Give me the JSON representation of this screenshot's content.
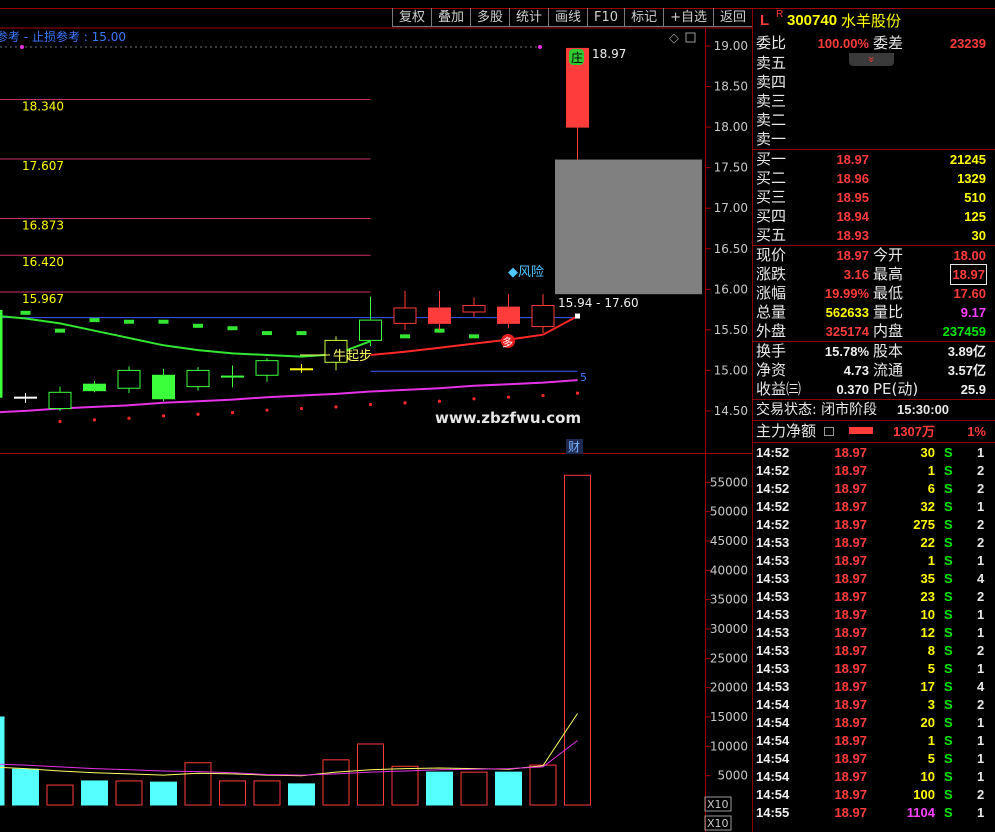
{
  "toolbar": {
    "buttons": [
      "复权",
      "叠加",
      "多股",
      "统计",
      "画线",
      "F10",
      "标记",
      "+自选",
      "返回"
    ]
  },
  "chart": {
    "ref_text": "参考 - 止损参考 : 15.00",
    "zhuang": "庄",
    "top_price": "18.97",
    "risk": "◆风险",
    "zone_label": "15.94 - 17.60",
    "niu": "牛起步",
    "duo": "多",
    "watermark": "www.zbzfwu.com",
    "cai": "财",
    "guide_label": "5",
    "x10_a": "X10",
    "x10_b": "X10"
  },
  "chart_data": [
    {
      "type": "candlestick",
      "price_ticks": [
        "19.00",
        "18.50",
        "18.00",
        "17.50",
        "17.00",
        "16.50",
        "16.00",
        "15.50",
        "15.00",
        "14.50"
      ],
      "candles": [
        {
          "o": 15.74,
          "c": 14.67,
          "h": 15.74,
          "l": 14.67,
          "color": "#3cff3c",
          "filled": true
        },
        {
          "o": 14.67,
          "c": 14.66,
          "h": 14.72,
          "l": 14.6,
          "color": "#ffffff",
          "filled": false
        },
        {
          "o": 14.53,
          "c": 14.73,
          "h": 14.8,
          "l": 14.5,
          "color": "#3cff3c",
          "filled": false
        },
        {
          "o": 14.83,
          "c": 14.75,
          "h": 14.87,
          "l": 14.73,
          "color": "#3cff3c",
          "filled": true
        },
        {
          "o": 14.78,
          "c": 15.0,
          "h": 15.05,
          "l": 14.72,
          "color": "#3cff3c",
          "filled": false
        },
        {
          "o": 14.94,
          "c": 14.65,
          "h": 15.02,
          "l": 14.62,
          "color": "#3cff3c",
          "filled": true
        },
        {
          "o": 14.8,
          "c": 15.0,
          "h": 15.04,
          "l": 14.75,
          "color": "#3cff3c",
          "filled": false
        },
        {
          "o": 14.93,
          "c": 14.92,
          "h": 15.06,
          "l": 14.79,
          "color": "#3cff3c",
          "filled": false
        },
        {
          "o": 14.94,
          "c": 15.12,
          "h": 15.15,
          "l": 14.86,
          "color": "#3cff3c",
          "filled": false
        },
        {
          "o": 15.02,
          "c": 15.01,
          "h": 15.08,
          "l": 14.97,
          "color": "#ffff00",
          "filled": false
        },
        {
          "o": 15.1,
          "c": 15.37,
          "h": 15.42,
          "l": 15.0,
          "color": "#c8ff3c",
          "filled": false
        },
        {
          "o": 15.37,
          "c": 15.62,
          "h": 15.91,
          "l": 15.3,
          "color": "#3cff3c",
          "filled": false
        },
        {
          "o": 15.58,
          "c": 15.77,
          "h": 15.98,
          "l": 15.5,
          "color": "#ff3c3c",
          "filled": false
        },
        {
          "o": 15.58,
          "c": 15.77,
          "h": 15.98,
          "l": 15.5,
          "color": "#ff3c3c",
          "filled": true
        },
        {
          "o": 15.72,
          "c": 15.8,
          "h": 15.9,
          "l": 15.66,
          "color": "#ff3c3c",
          "filled": false
        },
        {
          "o": 15.58,
          "c": 15.78,
          "h": 15.94,
          "l": 15.52,
          "color": "#ff3c3c",
          "filled": true
        },
        {
          "o": 15.54,
          "c": 15.8,
          "h": 15.94,
          "l": 15.46,
          "color": "#ff3c3c",
          "filled": false
        },
        {
          "o": 18.0,
          "c": 18.97,
          "h": 18.97,
          "l": 17.6,
          "color": "#ff3c3c",
          "filled": true
        }
      ],
      "levels": [
        "18.340",
        "17.607",
        "16.873",
        "16.420",
        "15.967"
      ],
      "level_color": "#c83264",
      "zone": {
        "low": 15.94,
        "high": 17.6,
        "color": "#808080"
      },
      "guides": [
        {
          "price": 15.65,
          "from": 0,
          "color": "#3c5aff"
        },
        {
          "price": 14.99,
          "from": 11,
          "color": "#3c5aff"
        }
      ],
      "series": [
        {
          "start": 0,
          "color": "#32e632",
          "values": [
            15.68,
            15.64,
            15.58,
            15.49,
            15.4,
            15.31,
            15.25,
            15.21,
            15.19,
            15.17,
            15.2,
            15.36
          ]
        },
        {
          "start": 11,
          "color": "#ff2828",
          "values": [
            15.19,
            15.23,
            15.28,
            15.33,
            15.38,
            15.44,
            15.67
          ]
        },
        {
          "start": 0,
          "color": "#e632e6",
          "values": [
            14.48,
            14.5,
            14.53,
            14.55,
            14.57,
            14.6,
            14.62,
            14.64,
            14.67,
            14.69,
            14.71,
            14.74,
            14.76,
            14.78,
            14.81,
            14.83,
            14.85,
            14.88
          ]
        }
      ],
      "marks": [
        15.76,
        15.71,
        15.49,
        15.62,
        15.6,
        15.6,
        15.55,
        15.52,
        15.46,
        15.46,
        null,
        null,
        15.42,
        15.49,
        15.42,
        null,
        null,
        null
      ],
      "mark_color": "#32e632"
    },
    {
      "type": "bar",
      "vol_ticks": [
        "55000",
        "50000",
        "45000",
        "40000",
        "35000",
        "30000",
        "25000",
        "20000",
        "15000",
        "10000",
        "5000"
      ],
      "values": [
        {
          "v": 15000,
          "color": "#54ffff",
          "filled": true
        },
        {
          "v": 6100,
          "color": "#54ffff",
          "filled": true
        },
        {
          "v": 3400,
          "color": "#ff3c3c",
          "filled": false
        },
        {
          "v": 4100,
          "color": "#54ffff",
          "filled": true
        },
        {
          "v": 4100,
          "color": "#ff3c3c",
          "filled": false
        },
        {
          "v": 3900,
          "color": "#54ffff",
          "filled": true
        },
        {
          "v": 7200,
          "color": "#ff3c3c",
          "filled": false
        },
        {
          "v": 4100,
          "color": "#ff3c3c",
          "filled": false
        },
        {
          "v": 4100,
          "color": "#ff3c3c",
          "filled": false
        },
        {
          "v": 3600,
          "color": "#54ffff",
          "filled": true
        },
        {
          "v": 7700,
          "color": "#ff3c3c",
          "filled": false
        },
        {
          "v": 10400,
          "color": "#ff3c3c",
          "filled": false
        },
        {
          "v": 6600,
          "color": "#ff3c3c",
          "filled": false
        },
        {
          "v": 5600,
          "color": "#54ffff",
          "filled": true
        },
        {
          "v": 5600,
          "color": "#ff3c3c",
          "filled": false
        },
        {
          "v": 5600,
          "color": "#54ffff",
          "filled": true
        },
        {
          "v": 6800,
          "color": "#ff3c3c",
          "filled": false
        },
        {
          "v": 56200,
          "color": "#ff3c3c",
          "filled": false
        }
      ],
      "series": [
        {
          "color": "#ffff64",
          "values": [
            6500,
            6200,
            5800,
            5500,
            5300,
            5100,
            5400,
            5300,
            5100,
            5000,
            5600,
            6000,
            6200,
            6300,
            6200,
            6100,
            6700,
            15600
          ]
        },
        {
          "color": "#e632e6",
          "values": [
            7000,
            6800,
            6500,
            6200,
            6000,
            5800,
            5700,
            5500,
            5200,
            5100,
            5300,
            5600,
            5800,
            6000,
            6100,
            6200,
            6500,
            11000
          ]
        }
      ]
    }
  ],
  "quote": {
    "header": {
      "flag": "L",
      "super": "R",
      "code": "300740",
      "name": "水羊股份"
    },
    "wei": {
      "label1": "委比",
      "val1": "100.00%",
      "label2": "委差",
      "val2": "23239"
    },
    "asks": [
      "卖五",
      "卖四",
      "卖三",
      "卖二",
      "卖一"
    ],
    "bids": [
      {
        "label": "买一",
        "price": "18.97",
        "vol": "21245"
      },
      {
        "label": "买二",
        "price": "18.96",
        "vol": "1329"
      },
      {
        "label": "买三",
        "price": "18.95",
        "vol": "510"
      },
      {
        "label": "买四",
        "price": "18.94",
        "vol": "125"
      },
      {
        "label": "买五",
        "price": "18.93",
        "vol": "30"
      }
    ],
    "stats": [
      {
        "l1": "现价",
        "v1": "18.97",
        "c1": "#ff3c3c",
        "l2": "今开",
        "v2": "18.00",
        "c2": "#ff3c3c"
      },
      {
        "l1": "涨跌",
        "v1": "3.16",
        "c1": "#ff3c3c",
        "l2": "最高",
        "v2": "18.97",
        "c2": "#ff3c3c"
      },
      {
        "l1": "涨幅",
        "v1": "19.99%",
        "c1": "#ff3c3c",
        "l2": "最低",
        "v2": "17.60",
        "c2": "#ff3c3c"
      },
      {
        "l1": "总量",
        "v1": "562633",
        "c1": "#ffff00",
        "l2": "量比",
        "v2": "9.17",
        "c2": "#ff40ff"
      },
      {
        "l1": "外盘",
        "v1": "325174",
        "c1": "#ff3c3c",
        "l2": "内盘",
        "v2": "237459",
        "c2": "#00e600"
      }
    ],
    "stats2": [
      {
        "l1": "换手",
        "v1": "15.78%",
        "l2": "股本",
        "v2": "3.89亿"
      },
      {
        "l1": "净资",
        "v1": "4.73",
        "l2": "流通",
        "v2": "3.57亿"
      },
      {
        "l1": "收益㈢",
        "v1": "0.370",
        "l2": "PE(动)",
        "v2": "25.9"
      }
    ],
    "state": {
      "text": "交易状态: 闭市阶段",
      "time": "15:30:00"
    },
    "main": {
      "label": "主力净额",
      "value": "1307万",
      "pct": "1%"
    },
    "ticks": [
      {
        "t": "14:52",
        "p": "18.97",
        "v": "30",
        "s": "S",
        "n": "1"
      },
      {
        "t": "14:52",
        "p": "18.97",
        "v": "1",
        "s": "S",
        "n": "2"
      },
      {
        "t": "14:52",
        "p": "18.97",
        "v": "6",
        "s": "S",
        "n": "2"
      },
      {
        "t": "14:52",
        "p": "18.97",
        "v": "32",
        "s": "S",
        "n": "1"
      },
      {
        "t": "14:52",
        "p": "18.97",
        "v": "275",
        "s": "S",
        "n": "2"
      },
      {
        "t": "14:53",
        "p": "18.97",
        "v": "22",
        "s": "S",
        "n": "2"
      },
      {
        "t": "14:53",
        "p": "18.97",
        "v": "1",
        "s": "S",
        "n": "1"
      },
      {
        "t": "14:53",
        "p": "18.97",
        "v": "35",
        "s": "S",
        "n": "4"
      },
      {
        "t": "14:53",
        "p": "18.97",
        "v": "23",
        "s": "S",
        "n": "2"
      },
      {
        "t": "14:53",
        "p": "18.97",
        "v": "10",
        "s": "S",
        "n": "1"
      },
      {
        "t": "14:53",
        "p": "18.97",
        "v": "12",
        "s": "S",
        "n": "1"
      },
      {
        "t": "14:53",
        "p": "18.97",
        "v": "8",
        "s": "S",
        "n": "2"
      },
      {
        "t": "14:53",
        "p": "18.97",
        "v": "5",
        "s": "S",
        "n": "1"
      },
      {
        "t": "14:53",
        "p": "18.97",
        "v": "17",
        "s": "S",
        "n": "4"
      },
      {
        "t": "14:54",
        "p": "18.97",
        "v": "3",
        "s": "S",
        "n": "2"
      },
      {
        "t": "14:54",
        "p": "18.97",
        "v": "20",
        "s": "S",
        "n": "1"
      },
      {
        "t": "14:54",
        "p": "18.97",
        "v": "1",
        "s": "S",
        "n": "1"
      },
      {
        "t": "14:54",
        "p": "18.97",
        "v": "5",
        "s": "S",
        "n": "1"
      },
      {
        "t": "14:54",
        "p": "18.97",
        "v": "10",
        "s": "S",
        "n": "1"
      },
      {
        "t": "14:54",
        "p": "18.97",
        "v": "100",
        "s": "S",
        "n": "2"
      },
      {
        "t": "14:55",
        "p": "18.97",
        "v": "1104",
        "s": "S",
        "n": "1",
        "vc": "#ff40ff"
      }
    ]
  }
}
